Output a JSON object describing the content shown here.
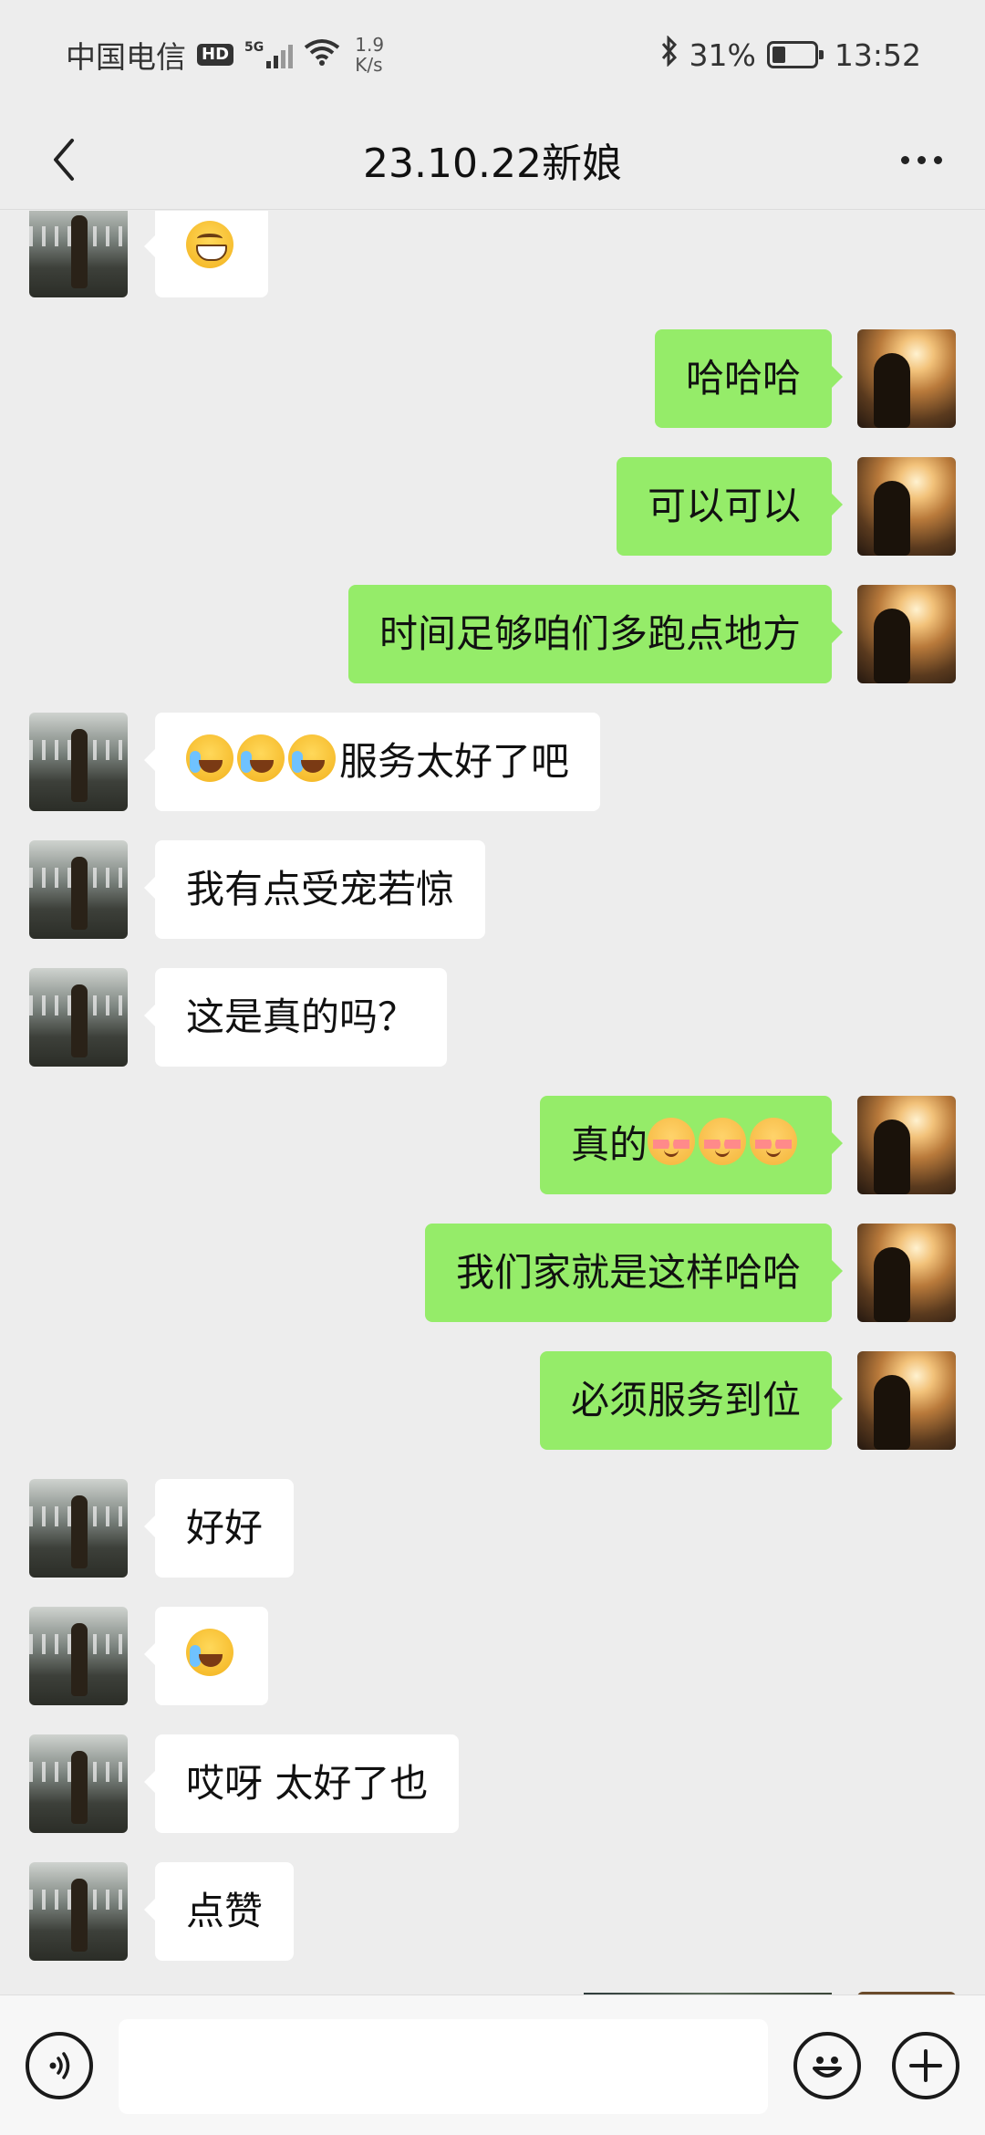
{
  "status_bar": {
    "carrier": "中国电信",
    "hd_badge": "HD",
    "network": "5G",
    "net_speed_value": "1.9",
    "net_speed_unit": "K/s",
    "battery_percent": "31%",
    "battery_level": 0.31,
    "time": "13:52"
  },
  "header": {
    "title": "23.10.22新娘",
    "back_icon": "chevron-left-icon",
    "more_icon": "more-dots-icon"
  },
  "messages": [
    {
      "side": "left",
      "text": ""
    },
    {
      "side": "right",
      "text": "哈哈哈"
    },
    {
      "side": "right",
      "text": "可以可以"
    },
    {
      "side": "right",
      "text": "时间足够咱们多跑点地方"
    },
    {
      "side": "left",
      "text": "服务太好了吧"
    },
    {
      "side": "left",
      "text": "我有点受宠若惊"
    },
    {
      "side": "left",
      "text": "这是真的吗？"
    },
    {
      "side": "right",
      "text": "真的"
    },
    {
      "side": "right",
      "text": "我们家就是这样哈哈"
    },
    {
      "side": "right",
      "text": "必须服务到位"
    },
    {
      "side": "left",
      "text": "好好"
    },
    {
      "side": "left",
      "text": ""
    },
    {
      "side": "left",
      "text": "哎呀 太好了也"
    },
    {
      "side": "left",
      "text": "点赞"
    }
  ],
  "input_bar": {
    "voice_icon": "voice-icon",
    "input_value": "",
    "emoji_icon": "emoji-icon",
    "plus_icon": "plus-icon"
  },
  "colors": {
    "background": "#ededed",
    "bubble_self": "#95ec69",
    "bubble_other": "#ffffff"
  }
}
